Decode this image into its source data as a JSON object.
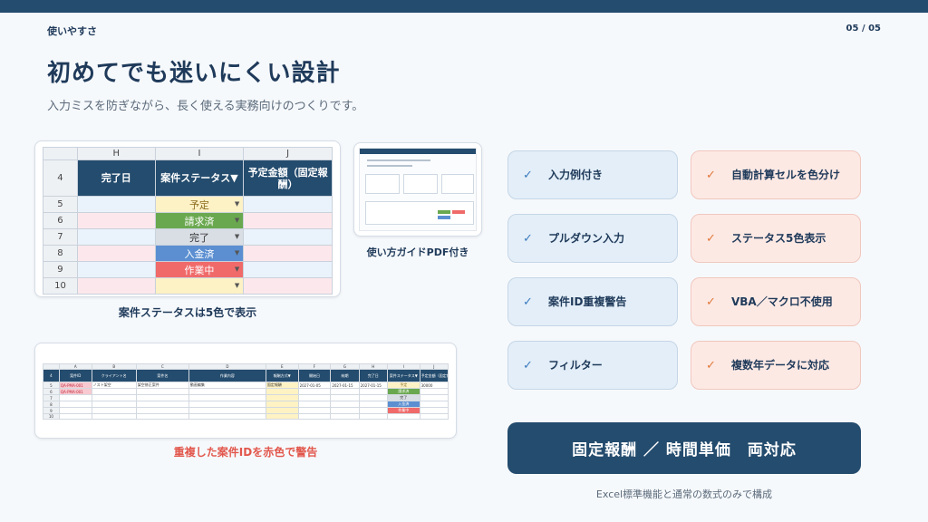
{
  "header": {
    "section": "使いやすさ",
    "page": "05 / 05"
  },
  "title": "初めてでも迷いにくい設計",
  "subtitle": "入力ミスを防ぎながら、長く使える実務向けのつくりです。",
  "sheet": {
    "col_letters": [
      "H",
      "I",
      "J"
    ],
    "header_row": "4",
    "headers": [
      "完了日",
      "案件ステータス▼",
      "予定金額（固定報酬）"
    ],
    "rows": [
      {
        "num": "5",
        "status": "予定",
        "color": "#fdf1c6",
        "text_color": "#8a6d1c"
      },
      {
        "num": "6",
        "status": "請求済",
        "color": "#6aa84f",
        "text_color": "#ffffff"
      },
      {
        "num": "7",
        "status": "完了",
        "color": "#d9dee5",
        "text_color": "#333333"
      },
      {
        "num": "8",
        "status": "入金済",
        "color": "#5b8fd1",
        "text_color": "#ffffff"
      },
      {
        "num": "9",
        "status": "作業中",
        "color": "#f06a6a",
        "text_color": "#ffffff"
      },
      {
        "num": "10",
        "status": "",
        "color": "#fdf1c6",
        "text_color": "#333333"
      }
    ],
    "caption": "案件ステータスは5色で表示"
  },
  "guide": {
    "caption": "使い方ガイドPDF付き"
  },
  "dup": {
    "col_letters": [
      "A",
      "B",
      "C",
      "D",
      "E",
      "F",
      "G",
      "H",
      "I",
      "J"
    ],
    "headers": [
      "案件ID",
      "クライアント名",
      "案件名",
      "作業内容",
      "報酬方式▼",
      "開始日",
      "納期",
      "完了日",
      "案件ステータス▼",
      "予定金額（固定報酬）"
    ],
    "row1": [
      "QA-PMA-001",
      "ノスト架空",
      "架空修正案件",
      "動画編集",
      "固定報酬",
      "2027-01-05",
      "2027-01-15",
      "2027-01-15",
      "予定",
      "30000"
    ],
    "row2_id": "QA-PMA-001",
    "statuses": [
      "予定",
      "請求済",
      "完了",
      "入金済",
      "作業中"
    ],
    "rownums": [
      "4",
      "5",
      "6",
      "7",
      "8",
      "9",
      "10"
    ],
    "caption": "重複した案件IDを赤色で警告"
  },
  "features": [
    {
      "label": "入力例付き",
      "style": "blue"
    },
    {
      "label": "自動計算セルを色分け",
      "style": "pink"
    },
    {
      "label": "プルダウン入力",
      "style": "blue"
    },
    {
      "label": "ステータス5色表示",
      "style": "pink"
    },
    {
      "label": "案件ID重複警告",
      "style": "blue"
    },
    {
      "label": "VBA／マクロ不使用",
      "style": "pink"
    },
    {
      "label": "フィルター",
      "style": "blue"
    },
    {
      "label": "複数年データに対応",
      "style": "pink"
    }
  ],
  "check_mark": "✓",
  "banner": "固定報酬 ／ 時間単価　両対応",
  "footnote": "Excel標準機能と通常の数式のみで構成",
  "colors": {
    "navy": "#244c6e",
    "blue_card": "#e3eef8",
    "pink_card": "#fde9e4",
    "warning": "#e2574c"
  }
}
